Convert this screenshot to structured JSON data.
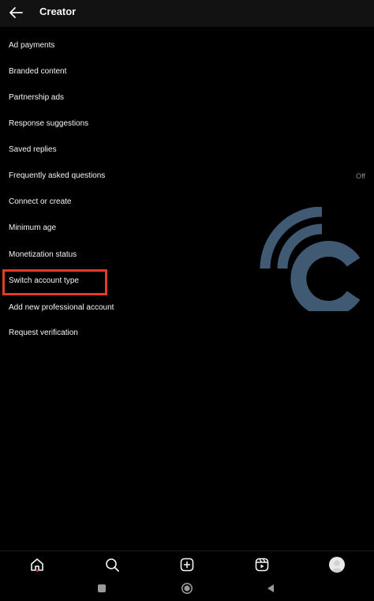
{
  "header": {
    "title": "Creator",
    "back_icon": "arrow-left-icon"
  },
  "menu": {
    "items": [
      {
        "label": "Ad payments"
      },
      {
        "label": "Branded content"
      },
      {
        "label": "Partnership ads"
      },
      {
        "label": "Response suggestions"
      },
      {
        "label": "Saved replies"
      },
      {
        "label": "Frequently asked questions",
        "value": "Off"
      },
      {
        "label": "Connect or create"
      },
      {
        "label": "Minimum age"
      },
      {
        "label": "Monetization status"
      },
      {
        "label": "Switch account type",
        "highlighted": true
      },
      {
        "label": "Add new professional account"
      },
      {
        "label": "Request verification"
      }
    ]
  },
  "highlight_color": "#e23b2a",
  "watermark_color": "#3f5a72",
  "bottom_nav": {
    "icons": [
      "home-icon",
      "search-icon",
      "create-icon",
      "reels-icon",
      "profile-avatar"
    ],
    "active": "home-icon",
    "notification_dot_color": "#e0245e"
  },
  "system_nav": {
    "icons": [
      "recents-icon",
      "home-circle-icon",
      "back-triangle-icon"
    ]
  }
}
